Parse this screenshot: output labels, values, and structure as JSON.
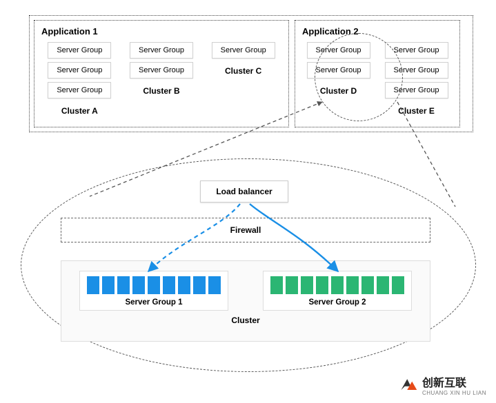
{
  "app1": {
    "title": "Application 1",
    "clusters": [
      {
        "label": "Cluster A",
        "groups": [
          "Server Group",
          "Server Group",
          "Server Group"
        ]
      },
      {
        "label": "Cluster B",
        "groups": [
          "Server Group",
          "Server Group"
        ]
      },
      {
        "label": "Cluster C",
        "groups": [
          "Server Group"
        ]
      }
    ]
  },
  "app2": {
    "title": "Application 2",
    "clusters": [
      {
        "label": "Cluster D",
        "groups": [
          "Server Group",
          "Server Group"
        ]
      },
      {
        "label": "Cluster E",
        "groups": [
          "Server Group",
          "Server Group",
          "Server Group"
        ]
      }
    ]
  },
  "lower": {
    "load_balancer": "Load balancer",
    "firewall": "Firewall",
    "cluster_label": "Cluster",
    "sg1": {
      "label": "Server Group 1",
      "blocks": 9,
      "color": "#1a8fe6"
    },
    "sg2": {
      "label": "Server Group 2",
      "blocks": 9,
      "color": "#2bb673"
    }
  },
  "watermark": {
    "brand": "创新互联",
    "sub": "CHUANG XIN HU LIAN"
  },
  "chart_data": {
    "type": "diagram",
    "description": "Architecture diagram showing two applications composed of clusters of server groups (top). One cluster (Cluster D) is highlighted and mapped to a detailed view (bottom ellipse) containing a load balancer above a firewall layer and a cluster with two server groups (color-coded blue & green, each 9 instances). Dashed lines map Cluster D → the detail ellipse. Solid/dashed blue arrows from the load balancer to each server group represent traffic distribution.",
    "applications": [
      {
        "name": "Application 1",
        "clusters": [
          {
            "name": "Cluster A",
            "server_groups": 3
          },
          {
            "name": "Cluster B",
            "server_groups": 2
          },
          {
            "name": "Cluster C",
            "server_groups": 1
          }
        ]
      },
      {
        "name": "Application 2",
        "clusters": [
          {
            "name": "Cluster D",
            "server_groups": 2,
            "highlighted": true
          },
          {
            "name": "Cluster E",
            "server_groups": 3
          }
        ]
      }
    ],
    "detail": {
      "maps_from": "Cluster D",
      "components": [
        "Load balancer",
        "Firewall",
        "Cluster"
      ],
      "server_groups": [
        {
          "name": "Server Group 1",
          "instances": 9,
          "color": "blue"
        },
        {
          "name": "Server Group 2",
          "instances": 9,
          "color": "green"
        }
      ],
      "edges": [
        {
          "from": "Load balancer",
          "to": "Server Group 1",
          "style": "dashed-blue-arrow"
        },
        {
          "from": "Load balancer",
          "to": "Server Group 2",
          "style": "solid-blue-arrow"
        }
      ]
    }
  }
}
